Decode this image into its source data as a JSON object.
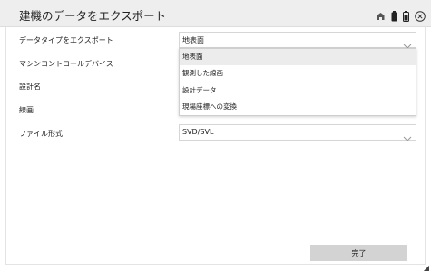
{
  "window": {
    "title": "建機のデータをエクスポート"
  },
  "status_icons": [
    "network-icon",
    "battery-icon",
    "close-icon"
  ],
  "form": {
    "export_type_label": "データタイプをエクスポート",
    "export_type_value": "地表面",
    "machine_label": "マシンコントロールデバイス",
    "design_label": "設計名",
    "line_label": "線画",
    "file_format_label": "ファイル形式",
    "file_format_value": "SVD/SVL"
  },
  "dropdown": {
    "options": [
      "地表面",
      "観測した線画",
      "設計データ",
      "現場座標への変換"
    ],
    "selected_index": 0
  },
  "footer": {
    "done_label": "完了"
  }
}
